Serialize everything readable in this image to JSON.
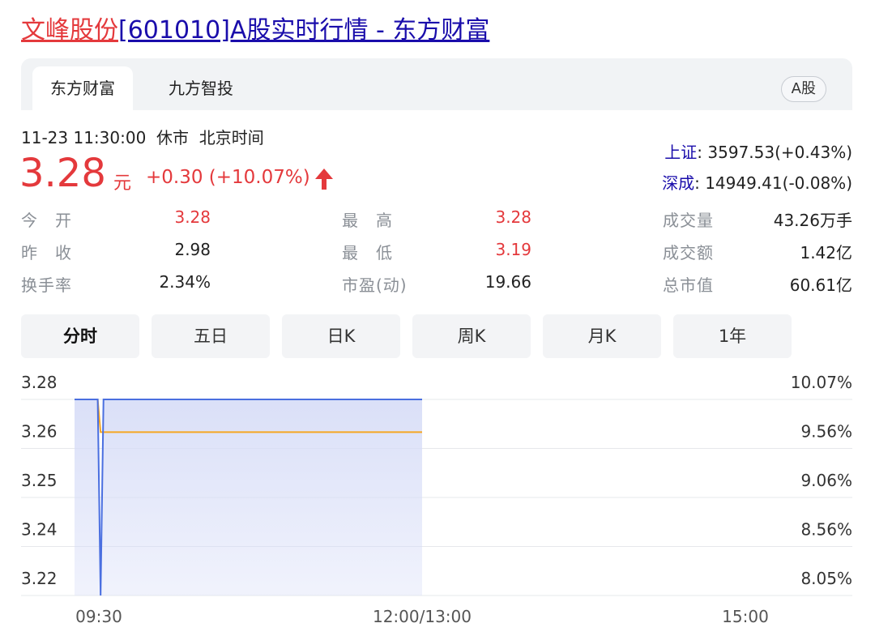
{
  "header": {
    "title_name": "文峰股份",
    "title_rest": "[601010]A股实时行情 - 东方财富"
  },
  "tabs": [
    {
      "label": "东方财富",
      "active": true
    },
    {
      "label": "九方智投",
      "active": false
    }
  ],
  "market_badge": "A股",
  "quote": {
    "datetime": "11-23 11:30:00",
    "status": "休市",
    "timezone": "北京时间",
    "price": "3.28",
    "unit": "元",
    "change": "+0.30 (+10.07%)",
    "direction": "up"
  },
  "indices": [
    {
      "name": "上证",
      "value": ": 3597.53(+0.43%)"
    },
    {
      "name": "深成",
      "value": ": 14949.41(-0.08%)"
    }
  ],
  "stats": [
    {
      "label": "今　开",
      "value": "3.28",
      "color": "red"
    },
    {
      "label": "最　高",
      "value": "3.28",
      "color": "red"
    },
    {
      "label": "成交量",
      "value": "43.26万手",
      "color": "black"
    },
    {
      "label": "昨　收",
      "value": "2.98",
      "color": "black"
    },
    {
      "label": "最　低",
      "value": "3.19",
      "color": "red"
    },
    {
      "label": "成交额",
      "value": "1.42亿",
      "color": "black"
    },
    {
      "label": "换手率",
      "value": "2.34%",
      "color": "black"
    },
    {
      "label": "市盈(动)",
      "value": "19.66",
      "color": "black"
    },
    {
      "label": "总市值",
      "value": "60.61亿",
      "color": "black"
    }
  ],
  "periods": [
    {
      "label": "分时",
      "active": true
    },
    {
      "label": "五日",
      "active": false
    },
    {
      "label": "日K",
      "active": false
    },
    {
      "label": "周K",
      "active": false
    },
    {
      "label": "月K",
      "active": false
    },
    {
      "label": "1年",
      "active": false
    }
  ],
  "colors": {
    "up": "#e4393c",
    "link": "#1a0dab",
    "price_line": "#4a6fe0",
    "avg_line": "#f5a623",
    "area_fill": "#d6dcf7"
  },
  "chart_data": {
    "type": "line",
    "left_ticks": [
      "3.28",
      "3.26",
      "3.25",
      "3.24",
      "3.22"
    ],
    "right_ticks": [
      "10.07%",
      "9.56%",
      "9.06%",
      "8.56%",
      "8.05%"
    ],
    "tick_values": [
      3.28,
      3.265,
      3.25,
      3.235,
      3.22
    ],
    "x_labels": [
      "09:30",
      "12:00/13:00",
      "15:00"
    ],
    "session_minutes": 240,
    "x_label_minutes": [
      0,
      120,
      240
    ],
    "ylim": [
      3.215,
      3.283
    ],
    "series": [
      {
        "role": "price",
        "points": [
          [
            0,
            3.28
          ],
          [
            7,
            3.28
          ],
          [
            8,
            3.28
          ],
          [
            9,
            3.215
          ],
          [
            10,
            3.28
          ],
          [
            120,
            3.28
          ]
        ]
      },
      {
        "role": "average",
        "points": [
          [
            0,
            3.28
          ],
          [
            8,
            3.28
          ],
          [
            9,
            3.27
          ],
          [
            120,
            3.27
          ]
        ]
      }
    ],
    "grid": true
  }
}
